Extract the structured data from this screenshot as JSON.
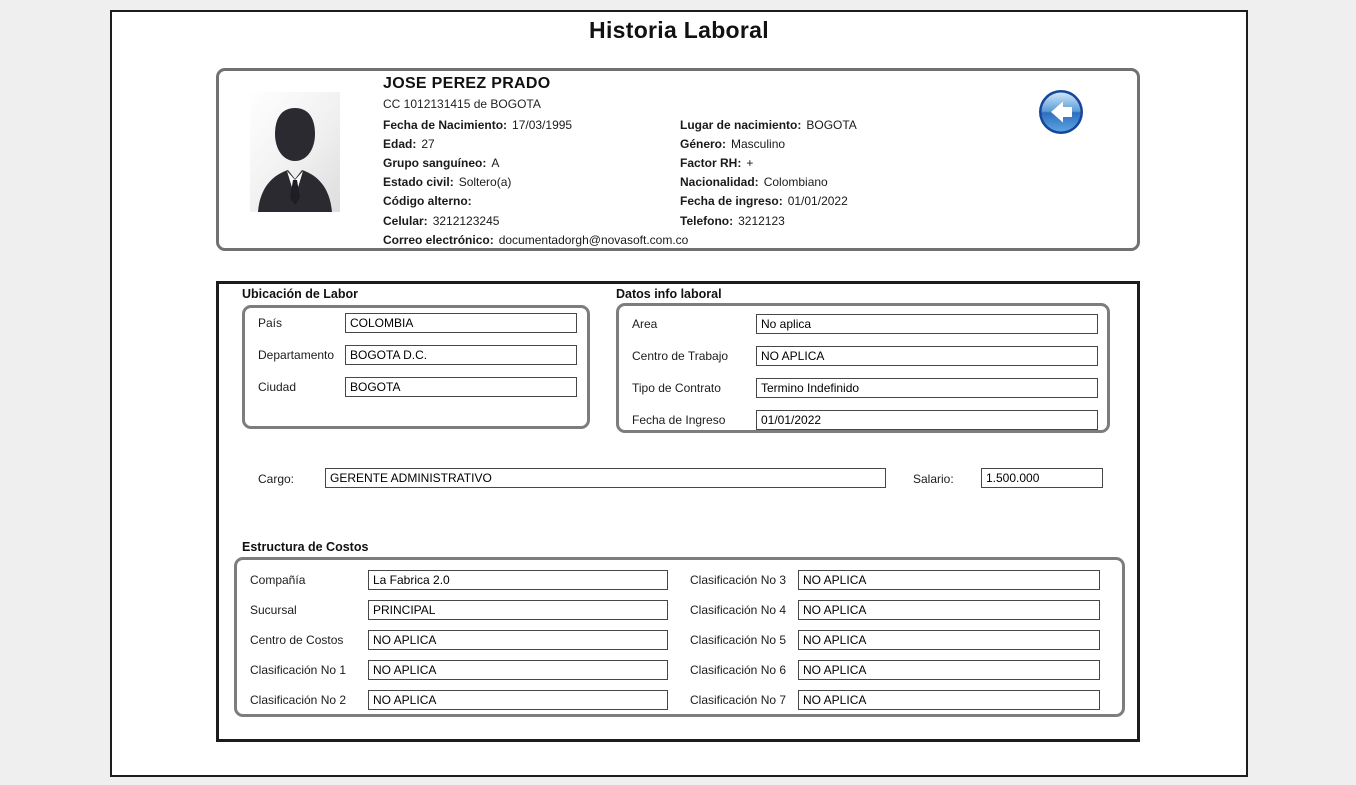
{
  "page": {
    "title": "Historia Laboral"
  },
  "colors": {
    "outer_border": "#1c1c1c",
    "fieldset_border": "#7d7d7d",
    "back_button_blue": "#2b6fc4"
  },
  "icons": {
    "back": "back-arrow-icon",
    "avatar": "person-silhouette-icon"
  },
  "profile": {
    "name": "JOSE PEREZ PRADO",
    "document": "CC 1012131415 de BOGOTA",
    "left_fields": [
      {
        "label": "Fecha de Nacimiento:",
        "value": "17/03/1995"
      },
      {
        "label": "Edad:",
        "value": "27"
      },
      {
        "label": "Grupo sanguíneo:",
        "value": "A"
      },
      {
        "label": "Estado civil:",
        "value": "Soltero(a)"
      },
      {
        "label": "Código alterno:",
        "value": ""
      },
      {
        "label": "Celular:",
        "value": "3212123245"
      },
      {
        "label": "Correo electrónico:",
        "value": "documentadorgh@novasoft.com.co"
      }
    ],
    "right_fields": [
      {
        "label": "Lugar de nacimiento:",
        "value": "BOGOTA"
      },
      {
        "label": "Género:",
        "value": "Masculino"
      },
      {
        "label": "Factor RH:",
        "value": "+"
      },
      {
        "label": "Nacionalidad:",
        "value": "Colombiano"
      },
      {
        "label": "Fecha de ingreso:",
        "value": "01/01/2022"
      },
      {
        "label": "Telefono:",
        "value": "3212123"
      }
    ]
  },
  "sections": {
    "ubicacion": {
      "title": "Ubicación de Labor",
      "fields": [
        {
          "label": "País",
          "value": "COLOMBIA"
        },
        {
          "label": "Departamento",
          "value": "BOGOTA D.C."
        },
        {
          "label": "Ciudad",
          "value": "BOGOTA"
        }
      ]
    },
    "datos_laboral": {
      "title": "Datos info laboral",
      "fields": [
        {
          "label": "Area",
          "value": "No aplica"
        },
        {
          "label": "Centro de Trabajo",
          "value": "NO APLICA"
        },
        {
          "label": "Tipo de Contrato",
          "value": "Termino Indefinido"
        },
        {
          "label": "Fecha de Ingreso",
          "value": "01/01/2022"
        }
      ]
    },
    "cargo_row": {
      "cargo_label": "Cargo:",
      "cargo_value": "GERENTE ADMINISTRATIVO",
      "salario_label": "Salario:",
      "salario_value": "1.500.000"
    },
    "estructura": {
      "title": "Estructura de Costos",
      "left_fields": [
        {
          "label": "Compañía",
          "value": "La Fabrica 2.0"
        },
        {
          "label": "Sucursal",
          "value": "PRINCIPAL"
        },
        {
          "label": "Centro de Costos",
          "value": "NO APLICA"
        },
        {
          "label": "Clasificación No 1",
          "value": "NO APLICA"
        },
        {
          "label": "Clasificación No 2",
          "value": "NO APLICA"
        }
      ],
      "right_fields": [
        {
          "label": "Clasificación No 3",
          "value": "NO APLICA"
        },
        {
          "label": "Clasificación No 4",
          "value": "NO APLICA"
        },
        {
          "label": "Clasificación No 5",
          "value": "NO APLICA"
        },
        {
          "label": "Clasificación No 6",
          "value": "NO APLICA"
        },
        {
          "label": "Clasificación No 7",
          "value": "NO APLICA"
        }
      ]
    }
  }
}
